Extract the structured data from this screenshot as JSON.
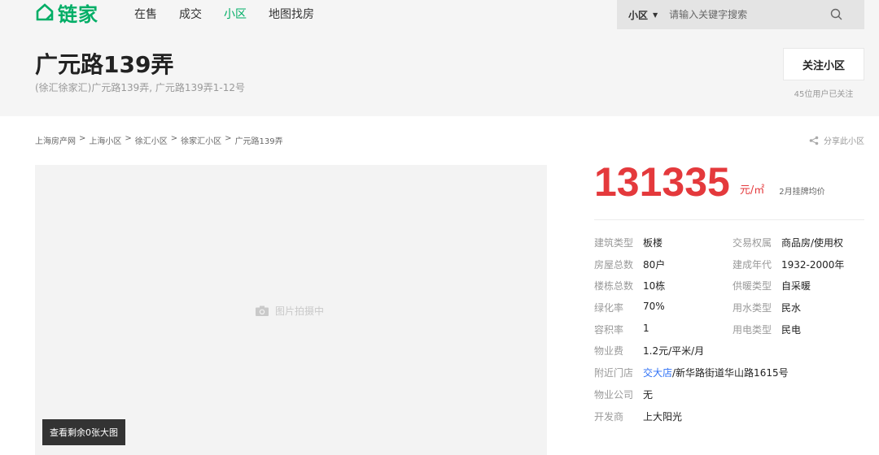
{
  "brand": {
    "name": "链家",
    "color": "#00ae66",
    "icon": "home-icon"
  },
  "nav": [
    {
      "label": "在售",
      "active": false
    },
    {
      "label": "成交",
      "active": false
    },
    {
      "label": "小区",
      "active": true
    },
    {
      "label": "地图找房",
      "active": false
    }
  ],
  "search": {
    "type": "小区",
    "placeholder": "请输入关键字搜索",
    "value": ""
  },
  "header": {
    "title": "广元路139弄",
    "address": "(徐汇徐家汇)广元路139弄, 广元路139弄1-12号",
    "follow_button": "关注小区",
    "follow_count": "45位用户已关注"
  },
  "breadcrumb": {
    "items": [
      "上海房产网",
      "上海小区",
      "徐汇小区",
      "徐家汇小区"
    ],
    "current": "广元路139弄",
    "separator": ">"
  },
  "share": {
    "label": "分享此小区"
  },
  "photo": {
    "placeholder": "图片拍摄中",
    "more_button": "查看剩余0张大图"
  },
  "price": {
    "value": "131335",
    "unit": "元/㎡",
    "note": "2月挂牌均价",
    "color": "#e4393c"
  },
  "info": {
    "building_type": {
      "label": "建筑类型",
      "value": "板楼"
    },
    "trade_right": {
      "label": "交易权属",
      "value": "商品房/使用权"
    },
    "households": {
      "label": "房屋总数",
      "value": "80户"
    },
    "build_year": {
      "label": "建成年代",
      "value": "1932-2000年"
    },
    "buildings": {
      "label": "楼栋总数",
      "value": "10栋"
    },
    "heating": {
      "label": "供暖类型",
      "value": "自采暖"
    },
    "green_rate": {
      "label": "绿化率",
      "value": "70%"
    },
    "water": {
      "label": "用水类型",
      "value": "民水"
    },
    "plot_ratio": {
      "label": "容积率",
      "value": "1"
    },
    "power": {
      "label": "用电类型",
      "value": "民电"
    },
    "property_fee": {
      "label": "物业费",
      "value": "1.2元/平米/月"
    },
    "nearby_store": {
      "label": "附近门店",
      "store": "交大店",
      "address": "/新华路街道华山路1615号"
    },
    "property_company": {
      "label": "物业公司",
      "value": "无"
    },
    "developer": {
      "label": "开发商",
      "value": "上大阳光"
    }
  }
}
